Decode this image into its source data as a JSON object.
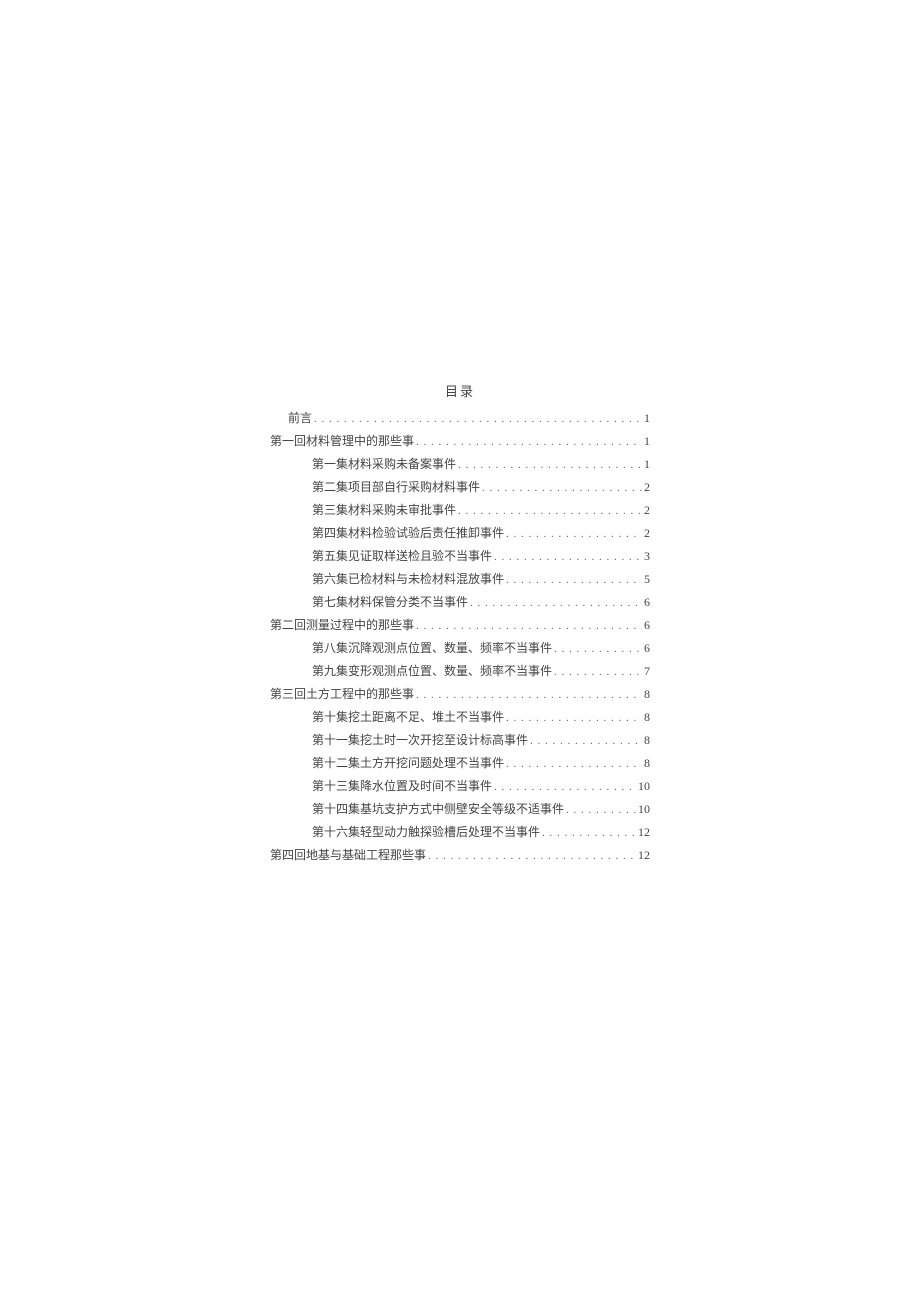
{
  "title": "目录",
  "entries": [
    {
      "label": "前言",
      "page": "1",
      "level": 0
    },
    {
      "label": "第一回材料管理中的那些事",
      "page": "1",
      "level": 1
    },
    {
      "label": "第一集材料采购未备案事件",
      "page": "1",
      "level": 2
    },
    {
      "label": "第二集项目部自行采购材料事件",
      "page": "2",
      "level": 2
    },
    {
      "label": "第三集材料采购未审批事件",
      "page": "2",
      "level": 2
    },
    {
      "label": "第四集材料检验试验后责任推卸事件",
      "page": "2",
      "level": 2
    },
    {
      "label": "第五集见证取样送检且验不当事件",
      "page": "3",
      "level": 2
    },
    {
      "label": "第六集已检材料与未检材料混放事件",
      "page": "5",
      "level": 2
    },
    {
      "label": "第七集材料保管分类不当事件",
      "page": "6",
      "level": 2
    },
    {
      "label": "第二回测量过程中的那些事",
      "page": "6",
      "level": 1
    },
    {
      "label": "第八集沉降观测点位置、数量、频率不当事件",
      "page": "6",
      "level": 2
    },
    {
      "label": "第九集变形观测点位置、数量、频率不当事件",
      "page": "7",
      "level": 2
    },
    {
      "label": "第三回土方工程中的那些事",
      "page": "8",
      "level": 1
    },
    {
      "label": "第十集挖土距离不足、堆土不当事件",
      "page": "8",
      "level": 2
    },
    {
      "label": "第十一集挖土时一次开挖至设计标高事件",
      "page": "8",
      "level": 2
    },
    {
      "label": "第十二集土方开挖问题处理不当事件",
      "page": "8",
      "level": 2
    },
    {
      "label": "第十三集降水位置及时间不当事件",
      "page": "10",
      "level": 2
    },
    {
      "label": "第十四集基坑支护方式中侧壁安全等级不适事件",
      "page": "10",
      "level": 2
    },
    {
      "label": "第十六集轻型动力触探验槽后处理不当事件",
      "page": "12",
      "level": 2
    },
    {
      "label": "第四回地基与基础工程那些事",
      "page": "12",
      "level": 1
    }
  ]
}
